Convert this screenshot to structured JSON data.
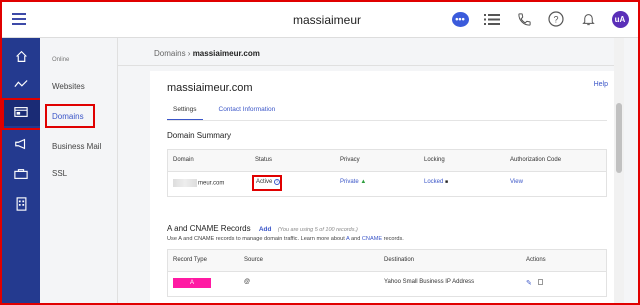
{
  "header": {
    "title": "massiaimeur",
    "avatar_initials": "uA"
  },
  "rail": {
    "items": [
      "home-icon",
      "activity-icon",
      "domains-icon",
      "megaphone-icon",
      "briefcase-icon",
      "building-icon"
    ]
  },
  "subnav": {
    "section_label": "Online",
    "items": [
      {
        "label": "Websites"
      },
      {
        "label": "Domains"
      },
      {
        "label": "Business Mail"
      },
      {
        "label": "SSL"
      }
    ]
  },
  "breadcrumb": {
    "root": "Domains",
    "sep": " › ",
    "current": "massiaimeur.com"
  },
  "card": {
    "title": "massiaimeur.com",
    "help": "Help",
    "tabs": [
      {
        "label": "Settings"
      },
      {
        "label": "Contact Information"
      }
    ]
  },
  "summary": {
    "heading": "Domain Summary",
    "columns": [
      "Domain",
      "Status",
      "Privacy",
      "Locking",
      "Authorization Code"
    ],
    "row": {
      "domain_suffix": "meur.com",
      "status": "Active",
      "privacy": "Private",
      "locking": "Locked",
      "auth": "View"
    }
  },
  "records": {
    "heading": "A and CNAME Records",
    "add": "Add",
    "usage": "(You are using 5 of 100 records.)",
    "desc_pre": "Use A and CNAME records to manage domain traffic. Learn more about ",
    "desc_a": "A",
    "desc_and": " and ",
    "desc_cname": "CNAME",
    "desc_post": " records.",
    "columns": [
      "Record Type",
      "Source",
      "Destination",
      "Actions"
    ],
    "rows": [
      {
        "type": "A",
        "source": "@",
        "destination": "Yahoo Small Business IP Address"
      }
    ]
  }
}
